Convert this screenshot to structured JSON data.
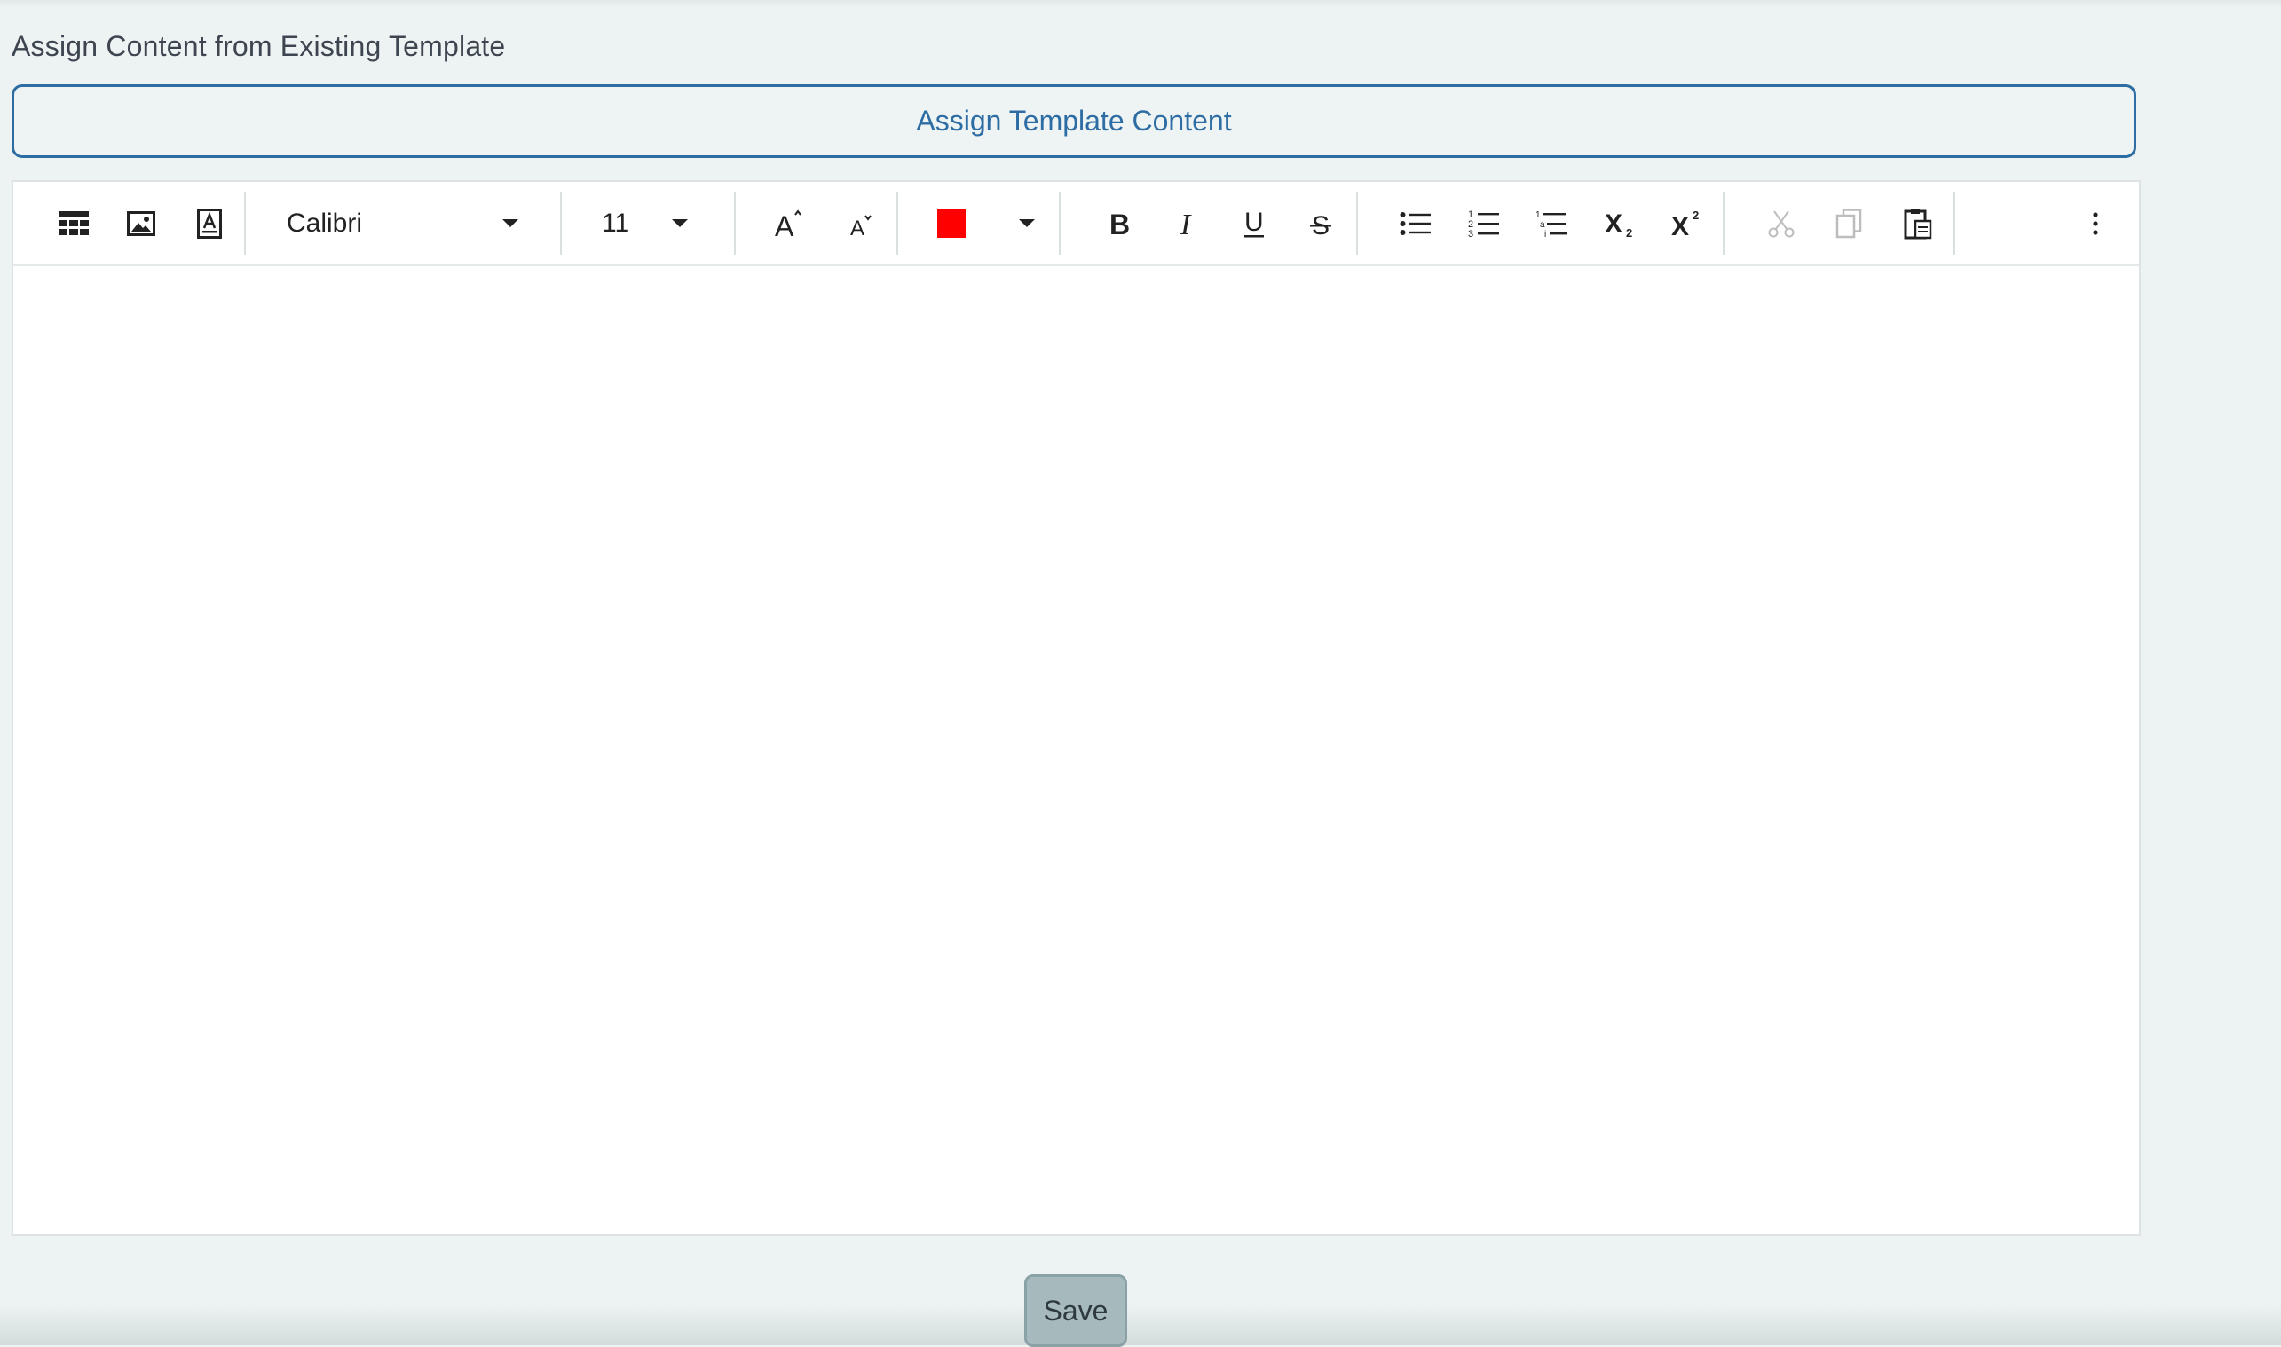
{
  "section": {
    "label": "Assign Content from Existing Template",
    "assign_button": "Assign Template Content"
  },
  "toolbar": {
    "insert_table": "table-icon",
    "insert_image": "image-icon",
    "text_box": "text-box-icon",
    "font_family": "Calibri",
    "font_size": "11",
    "grow_font": "grow-font-icon",
    "shrink_font": "shrink-font-icon",
    "font_color": "#ff0000",
    "bold": "bold-icon",
    "italic": "italic-icon",
    "underline": "underline-icon",
    "strikethrough": "strikethrough-icon",
    "bullets": "bullet-list-icon",
    "numbering": "numbered-list-icon",
    "multilevel": "multilevel-list-icon",
    "subscript": "subscript-icon",
    "superscript": "superscript-icon",
    "cut": "cut-icon",
    "copy": "copy-icon",
    "paste": "paste-icon",
    "more": "more-vertical-icon"
  },
  "footer": {
    "save_label": "Save"
  },
  "colors": {
    "accent": "#2e6da4",
    "background": "#edf3f3",
    "save_button": "#a6babd"
  }
}
